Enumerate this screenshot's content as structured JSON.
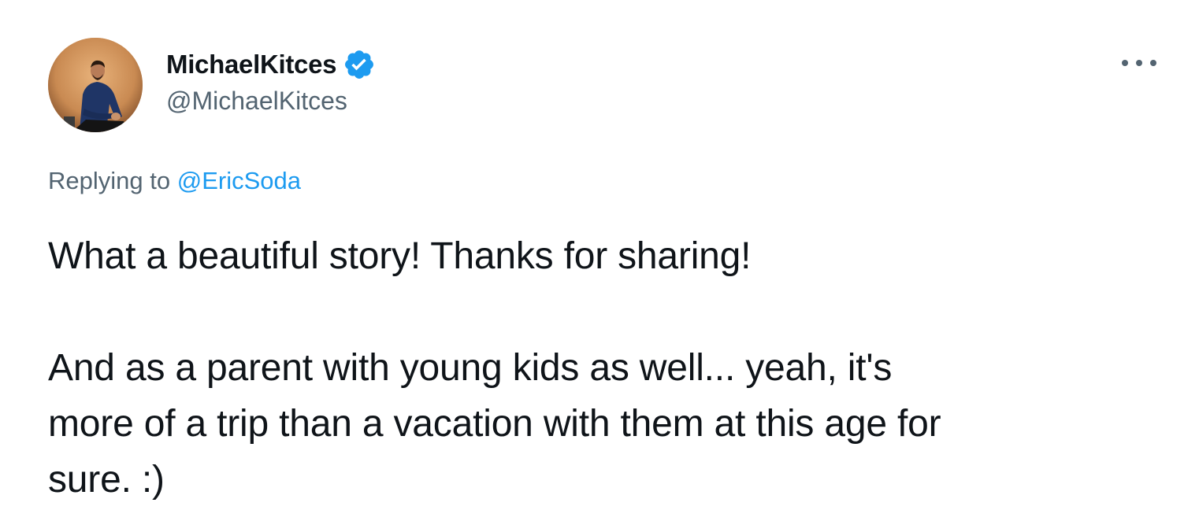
{
  "author": {
    "display_name": "MichaelKitces",
    "handle": "@MichaelKitces",
    "verified_icon": "verified-badge-icon",
    "verified_color": "#1d9bf0"
  },
  "menu": {
    "icon": "more-horizontal-icon"
  },
  "reply": {
    "prefix": "Replying to",
    "mention": "@EricSoda",
    "mention_color": "#1d9bf0"
  },
  "tweet": {
    "paragraphs": [
      "What a beautiful story! Thanks for sharing!",
      "And as a parent with young kids as well... yeah, it's\nmore of a trip than a vacation with them at this age for\nsure. :)"
    ]
  },
  "colors": {
    "text": "#0f1419",
    "secondary": "#536471",
    "accent": "#1d9bf0",
    "avatar_bg": "#d39a62"
  }
}
